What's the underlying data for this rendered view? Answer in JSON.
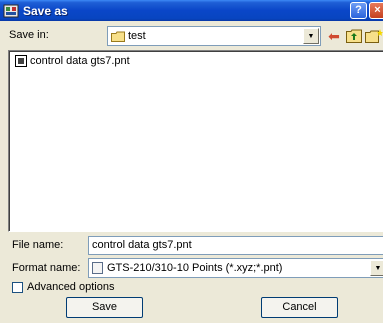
{
  "window": {
    "title": "Save as",
    "help_label": "?",
    "close_label": "×"
  },
  "save_in": {
    "label": "Save in:",
    "value": "test"
  },
  "files": [
    {
      "name": "control data gts7.pnt"
    }
  ],
  "file_name": {
    "label": "File name:",
    "value": "control data gts7.pnt"
  },
  "format": {
    "label": "Format name:",
    "value": "GTS-210/310-10 Points (*.xyz;*.pnt)"
  },
  "advanced": {
    "label": "Advanced options",
    "checked": false
  },
  "buttons": {
    "save": "Save",
    "cancel": "Cancel"
  },
  "colors": {
    "titlebar": "#0a46c8",
    "dialog_bg": "#ece9d8",
    "field_border": "#7f9db9"
  },
  "icons": {
    "app": "app-icon",
    "folder": "folder-icon",
    "back": "back-arrow-icon",
    "up": "up-folder-icon",
    "new_folder": "new-folder-icon",
    "file": "file-icon",
    "format": "format-icon"
  }
}
